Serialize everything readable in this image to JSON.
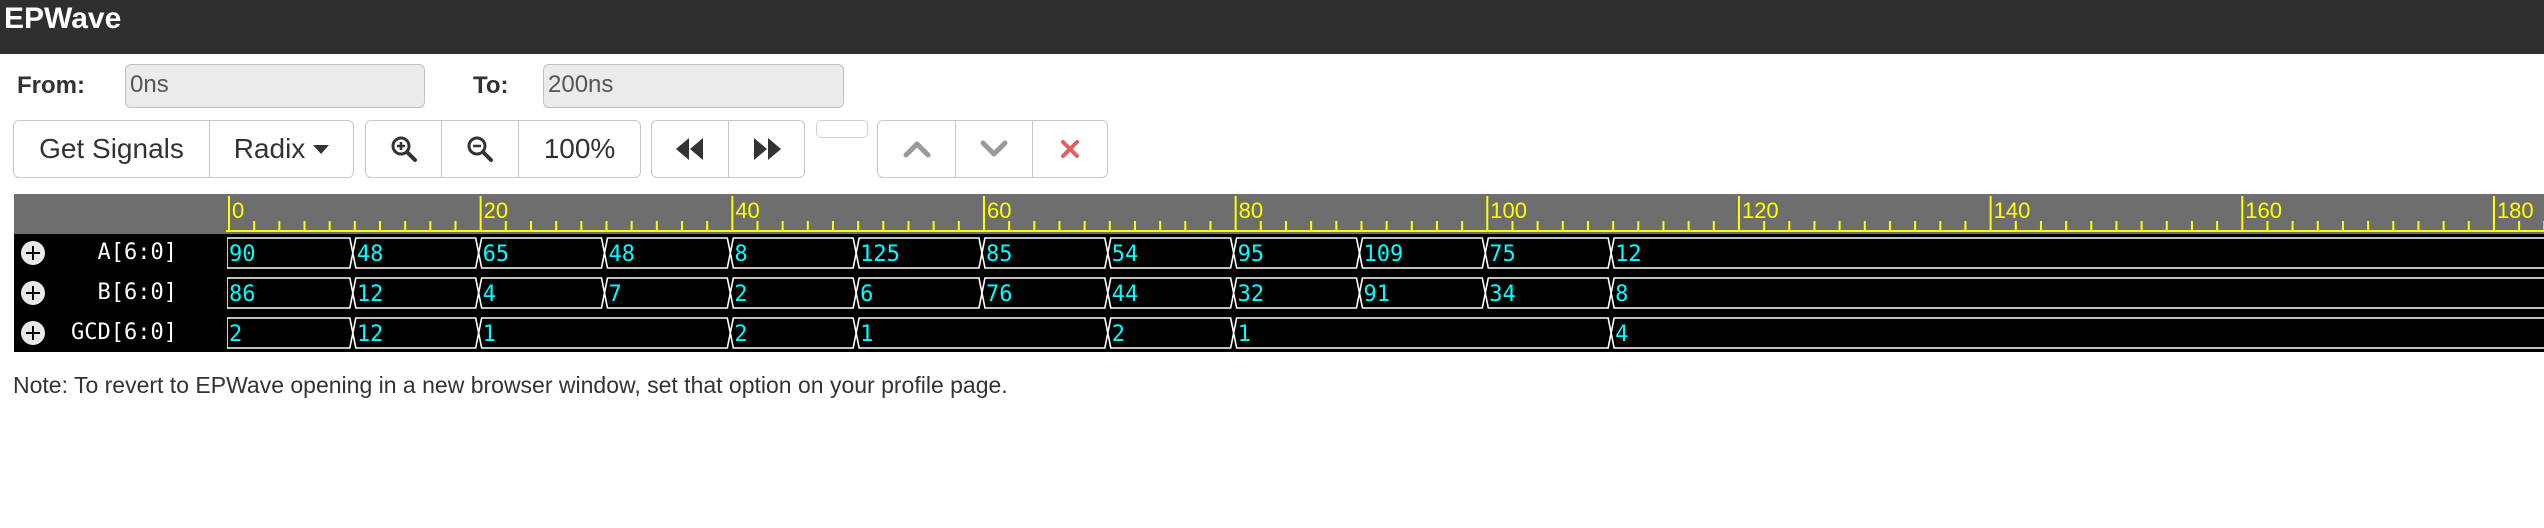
{
  "app": {
    "title": "EPWave"
  },
  "range": {
    "from_label": "From:",
    "from_value": "0ns",
    "to_label": "To:",
    "to_value": "200ns"
  },
  "toolbar": {
    "get_signals": "Get Signals",
    "radix": "Radix",
    "zoom_level": "100%",
    "zoom_in_icon": "zoom-in-icon",
    "zoom_out_icon": "zoom-out-icon",
    "prev_icon": "rewind-icon",
    "next_icon": "fast-forward-icon",
    "up_icon": "chevron-up-icon",
    "down_icon": "chevron-down-icon",
    "remove_icon": "close-icon"
  },
  "timeline": {
    "labels": [
      "0",
      "20",
      "40",
      "60",
      "80",
      "100",
      "120",
      "140",
      "160",
      "180"
    ],
    "unit": "ns",
    "end": 200
  },
  "signals": [
    {
      "name": "A[6:0]",
      "transitions": [
        0,
        10,
        20,
        30,
        40,
        50,
        60,
        70,
        80,
        90,
        100,
        110
      ],
      "values": [
        "90",
        "48",
        "65",
        "48",
        "8",
        "125",
        "85",
        "54",
        "95",
        "109",
        "75",
        "12"
      ]
    },
    {
      "name": "B[6:0]",
      "transitions": [
        0,
        10,
        20,
        30,
        40,
        50,
        60,
        70,
        80,
        90,
        100,
        110
      ],
      "values": [
        "86",
        "12",
        "4",
        "7",
        "2",
        "6",
        "76",
        "44",
        "32",
        "91",
        "34",
        "8"
      ]
    },
    {
      "name": "GCD[6:0]",
      "transitions": [
        0,
        10,
        20,
        40,
        50,
        70,
        80,
        110
      ],
      "values": [
        "2",
        "12",
        "1",
        "2",
        "1",
        "2",
        "1",
        "4"
      ]
    }
  ],
  "colors": {
    "ruler_tick": "#ffff00",
    "wave_value": "#00ffff",
    "wave_line": "#ffffff",
    "remove_icon": "#e06060",
    "titlebar": "#2f2f2f"
  },
  "note": "Note: To revert to EPWave opening in a new browser window, set that option on your profile page."
}
